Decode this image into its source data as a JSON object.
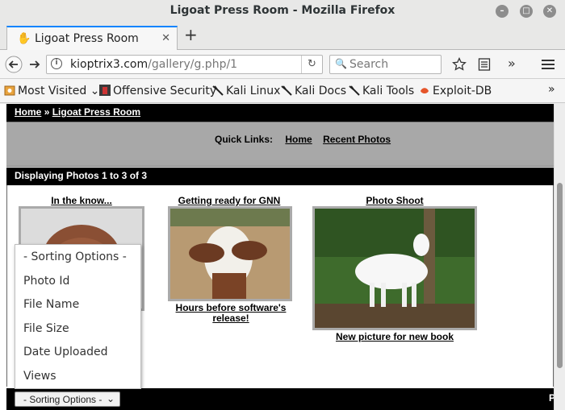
{
  "window": {
    "title": "Ligoat Press Room - Mozilla Firefox"
  },
  "tab": {
    "label": "Ligoat Press Room"
  },
  "navbar": {
    "url_host": "kioptrix3.com",
    "url_path": "/gallery/g.php/1",
    "search_placeholder": "Search"
  },
  "bookmarks": [
    {
      "label": "Most Visited",
      "icon": "gear-icon"
    },
    {
      "label": "Offensive Security",
      "icon": "offsec-icon"
    },
    {
      "label": "Kali Linux",
      "icon": "kali-dragon-icon"
    },
    {
      "label": "Kali Docs",
      "icon": "kali-dragon-icon"
    },
    {
      "label": "Kali Tools",
      "icon": "kali-dragon-icon"
    },
    {
      "label": "Exploit-DB",
      "icon": "exploitdb-icon"
    }
  ],
  "page": {
    "breadcrumb_home": "Home",
    "breadcrumb_sep": "»",
    "breadcrumb_current": "Ligoat Press Room",
    "quick_links_label": "Quick Links:",
    "quick_link_home": "Home",
    "quick_link_recent": "Recent Photos",
    "displaying": "Displaying Photos 1 to 3 of 3",
    "photos": [
      {
        "title": "In the know...",
        "caption": ""
      },
      {
        "title": "Getting ready for GNN",
        "caption": "Hours before software's release!"
      },
      {
        "title": "Photo Shoot",
        "caption": "New picture for new book"
      }
    ],
    "sort_select": {
      "selected": "- Sorting Options -"
    },
    "bottom_char": "P"
  },
  "dropdown": {
    "options": [
      "- Sorting Options -",
      "Photo Id",
      "File Name",
      "File Size",
      "Date Uploaded",
      "Views"
    ]
  },
  "colors": {
    "tab_accent": "#0a84ff",
    "page_bar": "#000000",
    "quicklinks_bg": "#a8a8a8"
  }
}
